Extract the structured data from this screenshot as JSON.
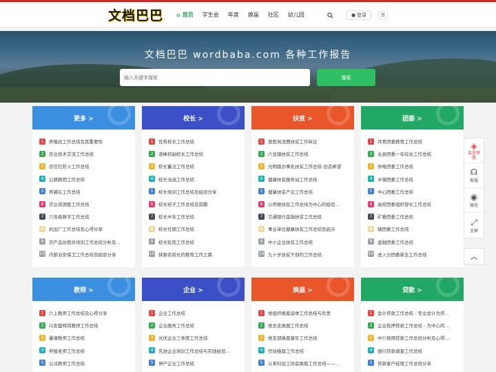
{
  "header": {
    "logo_text": "文档巴巴",
    "nav": [
      {
        "label": "首页",
        "active": true
      },
      {
        "label": "学生会",
        "active": false
      },
      {
        "label": "年度",
        "active": false
      },
      {
        "label": "换届",
        "active": false
      },
      {
        "label": "社区",
        "active": false
      },
      {
        "label": "幼儿园",
        "active": false
      }
    ],
    "login_label": "登录",
    "icons": {
      "home": "home-icon",
      "search": "search-icon",
      "user": "user-icon",
      "menu": "menu-icon"
    }
  },
  "hero": {
    "title": "文档巴巴 wordbaba.com 各种工作报告",
    "search_placeholder": "输入关键字搜索",
    "search_button": "搜索"
  },
  "cards": [
    {
      "title": "更多 >",
      "color": "#3b8fe0",
      "items": [
        "养殖段工作总结及其重要性",
        "农业技术交流工作总结",
        "农信社防火工作总结",
        "公路群团工作总结",
        "养路队工作总结",
        "农业资源股工作总结",
        "六年级数学工作总结",
        "机加厂工作总结及心得分享",
        "农产品协管员培训工作总结分析及...",
        "内部治安保卫工作总结及经验分享"
      ]
    },
    {
      "title": "校长 >",
      "color": "#3b4fc6",
      "items": [
        "优秀校长工作总结",
        "递棒校副校长工作总结",
        "校长蓄法工作总结",
        "校长当选工作总结",
        "校长培训工作总结及经验分享",
        "校长班子工作总结及前瞻",
        "校长半年工作总结",
        "校长任期工作总结",
        "校长轮岗工作总结",
        "挟索名校长的教育工作之路"
      ]
    },
    {
      "title": "扶贫 >",
      "color": "#e8562a",
      "items": [
        "兽医局消费扶贫工作纵论",
        "六龙镇扶贫工作总结",
        "光明路办事处扶贫工作总结-创造希望",
        "健康扶贫服务站工作总结",
        "健康扶贫产业工作总结",
        "以侨联扶贫工作总结为中心的经验...",
        "交通银行金融扶贫工作总结",
        "事业单位健康扶贫工作总结及启示",
        "中小企业扶贫工作总结",
        "九十岁扶贫干部的工作总结"
      ]
    },
    {
      "title": "团委 >",
      "color": "#22a865",
      "items": [
        "共青团委教育工作总结",
        "全县团委一年综合工作总结",
        "供电团委工作总结",
        "乡镇团委工作总结",
        "中心团委工作总结",
        "高校团委组织部长工作总结",
        "矿委团委工作总结",
        "镇团委工作总结",
        "金融团委工作总结",
        "进入分团委新生工作总结"
      ]
    },
    {
      "title": "教师 >",
      "color": "#3b8fe0",
      "items": [
        "六上教师工作总结及心得分享",
        "兴安盟特岗教师工作总结",
        "囊课教师工作总结",
        "养殖老师工作总结",
        "公派教师工作总结"
      ]
    },
    {
      "title": "企业 >",
      "color": "#3b4fc6",
      "items": [
        "企业工作总结",
        "企业服务工作总结",
        "光伏企业三季度工作总结",
        "先进企业培训工作总结与实践经验...",
        "停产企业工作总结"
      ]
    },
    {
      "title": "换届 >",
      "color": "#e8562a",
      "items": [
        "党组织换届选举工作总结与反思",
        "党总支换届工作总结",
        "党支部换届督年工作总结",
        "作协换届工作总结",
        "以来科加工协会换届工作总结——..."
      ]
    },
    {
      "title": "贷款 >",
      "color": "#22a865",
      "items": [
        "会计贷款工作总结 - 专业会计为贷...",
        "企业抵押贷款工作总结 - 为中心的...",
        "中介按揭贷款工作总结分析及心得...",
        "银行贷款调查工作总结",
        "贷款客户经理工作总结分享"
      ]
    }
  ],
  "sidebar_float": [
    {
      "label": "会员特惠",
      "icon": "diamond-icon"
    },
    {
      "label": "客服",
      "icon": "headset-icon"
    },
    {
      "label": "微信",
      "icon": "wechat-icon"
    },
    {
      "label": "全屏",
      "icon": "fullscreen-icon"
    }
  ],
  "back_to_top_icon": "chevron-up-icon"
}
